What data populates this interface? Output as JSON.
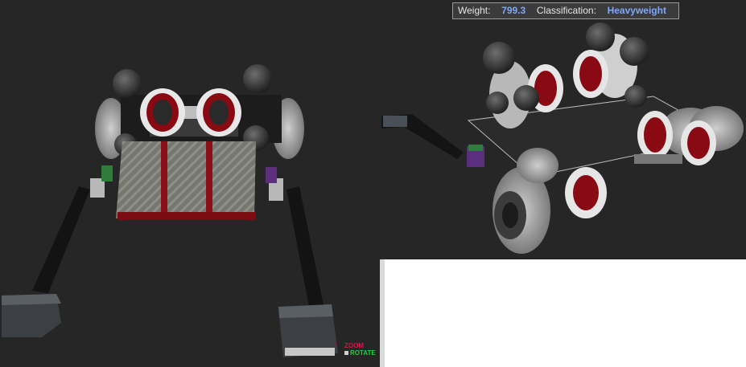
{
  "stats": {
    "weight_label": "Weight:",
    "weight_value": "799.3",
    "class_label": "Classification:",
    "class_value": "Heavyweight"
  },
  "controls": {
    "zoom_label": "ZOOM",
    "rotate_label": "ROTATE"
  },
  "colors": {
    "value_text": "#7fa6ff",
    "zoom": "#e0104a",
    "rotate": "#16d43a"
  }
}
